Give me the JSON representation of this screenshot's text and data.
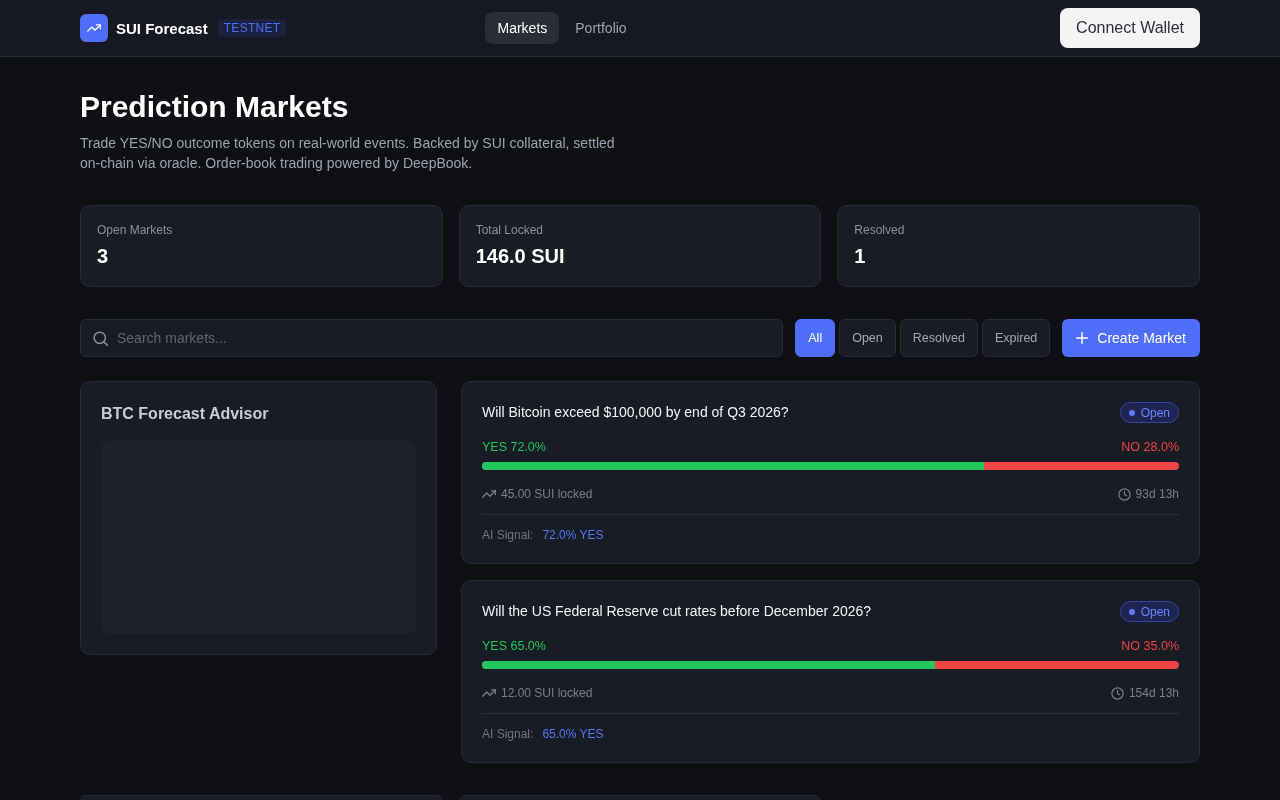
{
  "header": {
    "brand": "SUI Forecast",
    "network_badge": "TESTNET",
    "nav": [
      {
        "label": "Markets",
        "selected": true
      },
      {
        "label": "Portfolio",
        "selected": false
      }
    ],
    "connect_button": "Connect Wallet"
  },
  "page": {
    "title": "Prediction Markets",
    "description": "Trade YES/NO outcome tokens on real-world events. Backed by SUI collateral, settled on-chain via oracle. Order-book trading powered by DeepBook."
  },
  "stats": [
    {
      "label": "Open Markets",
      "value": "3"
    },
    {
      "label": "Total Locked",
      "value": "146.0 SUI"
    },
    {
      "label": "Resolved",
      "value": "1"
    }
  ],
  "toolbar": {
    "search": {
      "placeholder": "Search markets..."
    },
    "filters": [
      {
        "label": "All",
        "selected": true
      },
      {
        "label": "Open",
        "selected": false
      },
      {
        "label": "Resolved",
        "selected": false
      },
      {
        "label": "Expired",
        "selected": false
      }
    ],
    "create_button": "Create Market"
  },
  "advisor": {
    "title": "BTC Forecast Advisor"
  },
  "markets": [
    {
      "question": "Will Bitcoin exceed $100,000 by end of Q3 2026?",
      "status": "Open",
      "yes_label": "YES 72.0%",
      "no_label": "NO 28.0%",
      "level": 0.72,
      "locked": "45.00 SUI locked",
      "time_left": "93d 13h",
      "signal_label": "AI Signal:",
      "signal_value": "72.0% YES"
    },
    {
      "question": "Will the US Federal Reserve cut rates before December 2026?",
      "status": "Open",
      "yes_label": "YES 65.0%",
      "no_label": "NO 35.0%",
      "level": 0.65,
      "locked": "12.00 SUI locked",
      "time_left": "154d 13h",
      "signal_label": "AI Signal:",
      "signal_value": "65.0% YES"
    }
  ]
}
